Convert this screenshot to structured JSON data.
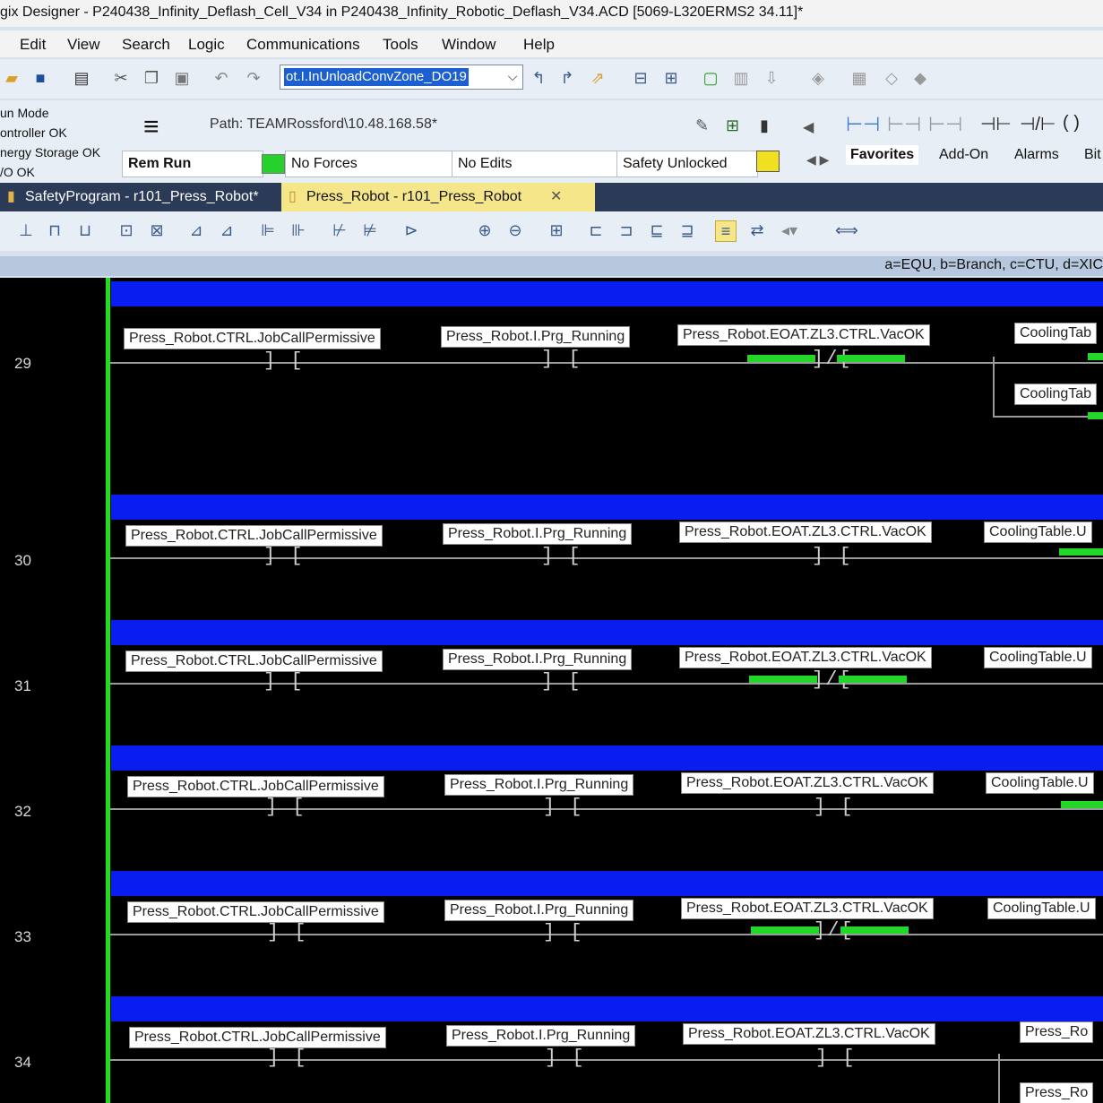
{
  "window": {
    "title": "gix Designer - P240438_Infinity_Deflash_Cell_V34 in P240438_Infinity_Robotic_Deflash_V34.ACD [5069-L320ERMS2 34.11]*"
  },
  "menu": [
    "Edit",
    "View",
    "Search",
    "Logic",
    "Communications",
    "Tools",
    "Window",
    "Help"
  ],
  "toolbar": {
    "tag_combo_value": "ot.I.InUnloadConvZone_DO19"
  },
  "controller_status": {
    "lines": [
      "un Mode",
      "ontroller OK",
      "nergy Storage OK",
      "/O OK"
    ],
    "path": "Path:  TEAMRossford\\10.48.168.58*",
    "mode": "Rem Run",
    "forces": "No Forces",
    "edits": "No Edits",
    "safety": "Safety Unlocked"
  },
  "instruction_tabs": [
    "Favorites",
    "Add-On",
    "Alarms",
    "Bit"
  ],
  "doc_tabs": [
    {
      "label": "SafetyProgram - r101_Press_Robot*",
      "active": false
    },
    {
      "label": "Press_Robot - r101_Press_Robot",
      "active": true
    }
  ],
  "legend": "a=EQU, b=Branch, c=CTU, d=XIC",
  "rungs": [
    {
      "number": "29",
      "tags": [
        "Press_Robot.CTRL.JobCallPermissive",
        "Press_Robot.I.Prg_Running",
        "Press_Robot.EOAT.ZL3.CTRL.VacOK",
        "CoolingTab",
        "CoolingTab"
      ]
    },
    {
      "number": "30",
      "tags": [
        "Press_Robot.CTRL.JobCallPermissive",
        "Press_Robot.I.Prg_Running",
        "Press_Robot.EOAT.ZL3.CTRL.VacOK",
        "CoolingTable.U"
      ]
    },
    {
      "number": "31",
      "tags": [
        "Press_Robot.CTRL.JobCallPermissive",
        "Press_Robot.I.Prg_Running",
        "Press_Robot.EOAT.ZL3.CTRL.VacOK",
        "CoolingTable.U"
      ]
    },
    {
      "number": "32",
      "tags": [
        "Press_Robot.CTRL.JobCallPermissive",
        "Press_Robot.I.Prg_Running",
        "Press_Robot.EOAT.ZL3.CTRL.VacOK",
        "CoolingTable.U"
      ]
    },
    {
      "number": "33",
      "tags": [
        "Press_Robot.CTRL.JobCallPermissive",
        "Press_Robot.I.Prg_Running",
        "Press_Robot.EOAT.ZL3.CTRL.VacOK",
        "CoolingTable.U"
      ]
    },
    {
      "number": "34",
      "tags": [
        "Press_Robot.CTRL.JobCallPermissive",
        "Press_Robot.I.Prg_Running",
        "Press_Robot.EOAT.ZL3.CTRL.VacOK",
        "Press_Ro",
        "Press_Ro"
      ]
    }
  ],
  "colors": {
    "rail": "#1be01b",
    "rung_header": "#0a1df0",
    "energized": "#22d62a"
  }
}
